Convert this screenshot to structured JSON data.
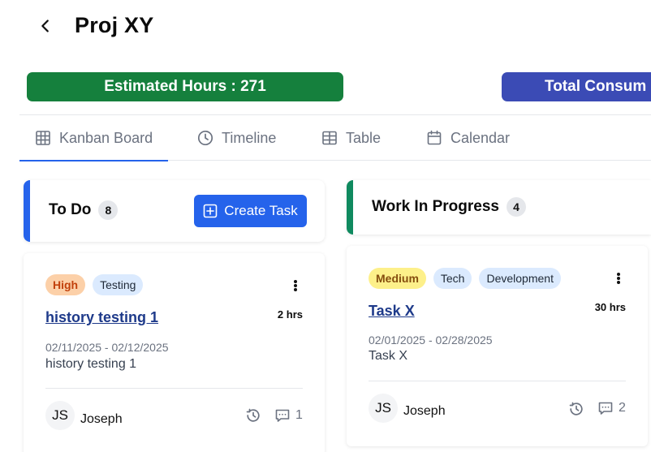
{
  "header": {
    "title": "Proj XY",
    "back_icon": "chevron-left-icon"
  },
  "stats": {
    "estimated": {
      "label": "Estimated Hours : 271",
      "color": "#15803d"
    },
    "consumed": {
      "label": "Total Consum",
      "color": "#3b4bb5"
    }
  },
  "tabs": [
    {
      "label": "Kanban Board",
      "icon": "grid-icon",
      "active": true
    },
    {
      "label": "Timeline",
      "icon": "clock-icon",
      "active": false
    },
    {
      "label": "Table",
      "icon": "table-icon",
      "active": false
    },
    {
      "label": "Calendar",
      "icon": "calendar-icon",
      "active": false
    }
  ],
  "accent_color": "#2563eb",
  "columns": [
    {
      "title": "To Do",
      "count": "8",
      "color": "#2563eb",
      "create_label": "Create Task",
      "cards": [
        {
          "tags": [
            "High",
            "Testing"
          ],
          "title": "history testing 1",
          "hours": "2 hrs",
          "dates": "02/11/2025 - 02/12/2025",
          "description": "history testing 1",
          "assignee_initials": "JS",
          "assignee": "Joseph",
          "comments": "1"
        }
      ]
    },
    {
      "title": "Work In Progress",
      "count": "4",
      "color": "#0f8a5f",
      "cards": [
        {
          "tags": [
            "Medium",
            "Tech",
            "Development"
          ],
          "title": "Task X",
          "hours": "30 hrs",
          "dates": "02/01/2025 - 02/28/2025",
          "description": "Task X",
          "assignee_initials": "JS",
          "assignee": "Joseph",
          "comments": "2"
        }
      ]
    }
  ]
}
